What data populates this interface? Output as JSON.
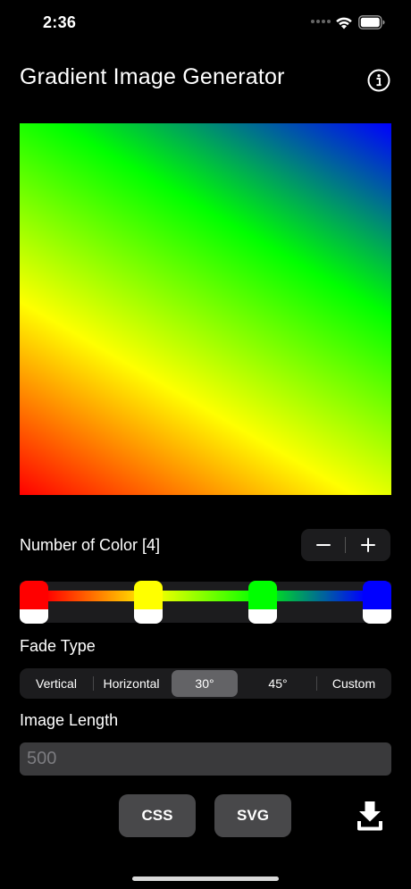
{
  "status_bar": {
    "time": "2:36",
    "icons": [
      "cellular-dots-icon",
      "wifi-icon",
      "battery-icon"
    ]
  },
  "header": {
    "title": "Gradient Image Generator",
    "info_icon": "info-circle-icon"
  },
  "preview": {
    "angle": "30°",
    "colors": [
      "#ff0000",
      "#ffff00",
      "#00ff00",
      "#0000ff"
    ]
  },
  "colors_section": {
    "label": "Number of Color [4]",
    "count": 4,
    "minus_icon": "minus-icon",
    "plus_icon": "plus-icon"
  },
  "color_stops": [
    {
      "color": "#ff0000",
      "position": 0.0
    },
    {
      "color": "#ffff00",
      "position": 0.333
    },
    {
      "color": "#00ff00",
      "position": 0.667
    },
    {
      "color": "#0000ff",
      "position": 1.0
    }
  ],
  "fade_type": {
    "label": "Fade Type",
    "options": [
      "Vertical",
      "Horizontal",
      "30°",
      "45°",
      "Custom"
    ],
    "selected": "30°"
  },
  "image_length": {
    "label": "Image Length",
    "value": "",
    "placeholder": "500"
  },
  "actions": {
    "css_label": "CSS",
    "svg_label": "SVG",
    "download_icon": "download-icon"
  }
}
